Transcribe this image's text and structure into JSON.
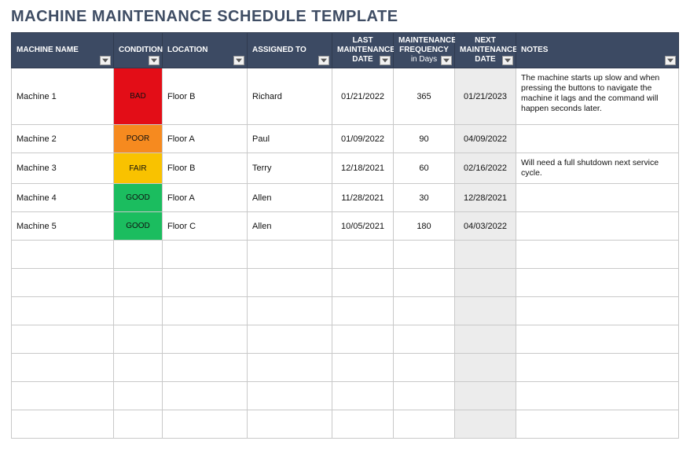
{
  "title": "MACHINE MAINTENANCE SCHEDULE TEMPLATE",
  "columns": {
    "machine_name": "MACHINE NAME",
    "condition": "CONDITION",
    "location": "LOCATION",
    "assigned_to": "ASSIGNED TO",
    "last_maint": "LAST MAINTENANCE DATE",
    "freq": "MAINTENANCE FREQUENCY",
    "freq_sub": "in Days",
    "next_maint": "NEXT MAINTENANCE DATE",
    "notes": "NOTES"
  },
  "condition_colors": {
    "BAD": "#e30d17",
    "POOR": "#f68a1f",
    "FAIR": "#f9c200",
    "GOOD": "#1bbd5f"
  },
  "rows": [
    {
      "machine_name": "Machine 1",
      "condition": "BAD",
      "location": "Floor B",
      "assigned_to": "Richard",
      "last_maint": "01/21/2022",
      "freq": "365",
      "next_maint": "01/21/2023",
      "notes": "The machine starts up slow and when pressing the buttons to navigate the machine it lags and the command will happen seconds later."
    },
    {
      "machine_name": "Machine 2",
      "condition": "POOR",
      "location": "Floor A",
      "assigned_to": "Paul",
      "last_maint": "01/09/2022",
      "freq": "90",
      "next_maint": "04/09/2022",
      "notes": ""
    },
    {
      "machine_name": "Machine 3",
      "condition": "FAIR",
      "location": "Floor B",
      "assigned_to": "Terry",
      "last_maint": "12/18/2021",
      "freq": "60",
      "next_maint": "02/16/2022",
      "notes": "Will need a full shutdown next service cycle."
    },
    {
      "machine_name": "Machine 4",
      "condition": "GOOD",
      "location": "Floor A",
      "assigned_to": "Allen",
      "last_maint": "11/28/2021",
      "freq": "30",
      "next_maint": "12/28/2021",
      "notes": ""
    },
    {
      "machine_name": "Machine 5",
      "condition": "GOOD",
      "location": "Floor C",
      "assigned_to": "Allen",
      "last_maint": "10/05/2021",
      "freq": "180",
      "next_maint": "04/03/2022",
      "notes": ""
    },
    {
      "machine_name": "",
      "condition": "",
      "location": "",
      "assigned_to": "",
      "last_maint": "",
      "freq": "",
      "next_maint": "",
      "notes": ""
    },
    {
      "machine_name": "",
      "condition": "",
      "location": "",
      "assigned_to": "",
      "last_maint": "",
      "freq": "",
      "next_maint": "",
      "notes": ""
    },
    {
      "machine_name": "",
      "condition": "",
      "location": "",
      "assigned_to": "",
      "last_maint": "",
      "freq": "",
      "next_maint": "",
      "notes": ""
    },
    {
      "machine_name": "",
      "condition": "",
      "location": "",
      "assigned_to": "",
      "last_maint": "",
      "freq": "",
      "next_maint": "",
      "notes": ""
    },
    {
      "machine_name": "",
      "condition": "",
      "location": "",
      "assigned_to": "",
      "last_maint": "",
      "freq": "",
      "next_maint": "",
      "notes": ""
    },
    {
      "machine_name": "",
      "condition": "",
      "location": "",
      "assigned_to": "",
      "last_maint": "",
      "freq": "",
      "next_maint": "",
      "notes": ""
    },
    {
      "machine_name": "",
      "condition": "",
      "location": "",
      "assigned_to": "",
      "last_maint": "",
      "freq": "",
      "next_maint": "",
      "notes": ""
    }
  ]
}
